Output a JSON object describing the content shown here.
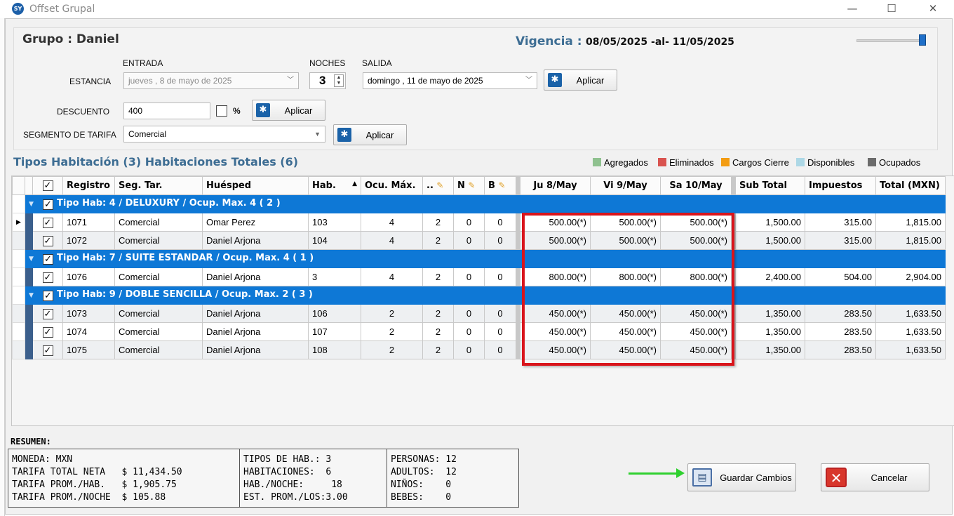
{
  "window": {
    "title": "Offset Grupal",
    "app_icon_text": "SY",
    "minimize": "—",
    "maximize": "☐",
    "close": "✕"
  },
  "header": {
    "grupo": "Grupo : Daniel",
    "vigencia_label": "Vigencia :",
    "vigencia_value": "08/05/2025 -al- 11/05/2025"
  },
  "stay": {
    "entrada_label": "ENTRADA",
    "noches_label": "NOCHES",
    "salida_label": "SALIDA",
    "estancia_label": "ESTANCIA",
    "entrada_value": "jueves  ,   8 de    mayo    de 2025",
    "noches_value": "3",
    "salida_value": "domingo , 11 de     mayo     de 2025",
    "apply_label": "Aplicar"
  },
  "discount": {
    "label": "DESCUENTO",
    "value": "400",
    "percent_label": "%",
    "apply_label": "Aplicar"
  },
  "segment": {
    "label": "SEGMENTO DE TARIFA",
    "value": "Comercial",
    "apply_label": "Aplicar"
  },
  "tipos_title": "Tipos Habitación (3) Habitaciones Totales (6)",
  "legend": [
    {
      "label": "Agregados",
      "color": "#8fc18f"
    },
    {
      "label": "Eliminados",
      "color": "#d9534f"
    },
    {
      "label": "Cargos Cierre",
      "color": "#f39c12"
    },
    {
      "label": "Disponibles",
      "color": "#add8e6"
    },
    {
      "label": "Ocupados",
      "color": "#6b6b6b"
    }
  ],
  "grid": {
    "columns": {
      "registro": "Registro",
      "seg": "Seg. Tar.",
      "huesped": "Huésped",
      "hab": "Hab.",
      "ocu": "Ocu. Máx.",
      "dots": "..",
      "n": "N",
      "b": "B",
      "d1": "Ju 8/May",
      "d2": "Vi 9/May",
      "d3": "Sa 10/May",
      "sub": "Sub Total",
      "imp": "Impuestos",
      "total": "Total (MXN)"
    },
    "groups": [
      {
        "label": "Tipo Hab: 4 / DELUXURY / Ocup. Max. 4 ( 2 )"
      },
      {
        "label": "Tipo Hab: 7 / SUITE ESTANDAR / Ocup. Max. 4 ( 1 )"
      },
      {
        "label": "Tipo Hab: 9 / DOBLE SENCILLA / Ocup. Max. 2 ( 3 )"
      }
    ],
    "rows": [
      {
        "registro": "1071",
        "seg": "Comercial",
        "huesped": "Omar Perez",
        "hab": "103",
        "ocu": "4",
        "dots": "2",
        "n": "0",
        "b": "0",
        "d1": "500.00(*)",
        "d2": "500.00(*)",
        "d3": "500.00(*)",
        "sub": "1,500.00",
        "imp": "315.00",
        "total": "1,815.00"
      },
      {
        "registro": "1072",
        "seg": "Comercial",
        "huesped": "Daniel Arjona",
        "hab": "104",
        "ocu": "4",
        "dots": "2",
        "n": "0",
        "b": "0",
        "d1": "500.00(*)",
        "d2": "500.00(*)",
        "d3": "500.00(*)",
        "sub": "1,500.00",
        "imp": "315.00",
        "total": "1,815.00"
      },
      {
        "registro": "1076",
        "seg": "Comercial",
        "huesped": "Daniel Arjona",
        "hab": "3",
        "ocu": "4",
        "dots": "2",
        "n": "0",
        "b": "0",
        "d1": "800.00(*)",
        "d2": "800.00(*)",
        "d3": "800.00(*)",
        "sub": "2,400.00",
        "imp": "504.00",
        "total": "2,904.00"
      },
      {
        "registro": "1073",
        "seg": "Comercial",
        "huesped": "Daniel Arjona",
        "hab": "106",
        "ocu": "2",
        "dots": "2",
        "n": "0",
        "b": "0",
        "d1": "450.00(*)",
        "d2": "450.00(*)",
        "d3": "450.00(*)",
        "sub": "1,350.00",
        "imp": "283.50",
        "total": "1,633.50"
      },
      {
        "registro": "1074",
        "seg": "Comercial",
        "huesped": "Daniel Arjona",
        "hab": "107",
        "ocu": "2",
        "dots": "2",
        "n": "0",
        "b": "0",
        "d1": "450.00(*)",
        "d2": "450.00(*)",
        "d3": "450.00(*)",
        "sub": "1,350.00",
        "imp": "283.50",
        "total": "1,633.50"
      },
      {
        "registro": "1075",
        "seg": "Comercial",
        "huesped": "Daniel Arjona",
        "hab": "108",
        "ocu": "2",
        "dots": "2",
        "n": "0",
        "b": "0",
        "d1": "450.00(*)",
        "d2": "450.00(*)",
        "d3": "450.00(*)",
        "sub": "1,350.00",
        "imp": "283.50",
        "total": "1,633.50"
      }
    ]
  },
  "resumen": {
    "label": "RESUMEN:",
    "col1": {
      "line1": "MONEDA: MXN",
      "line2": "TARIFA TOTAL NETA   $ 11,434.50",
      "line3": "TARIFA PROM./HAB.   $ 1,905.75",
      "line4": "TARIFA PROM./NOCHE  $ 105.88"
    },
    "col2": {
      "line1": "TIPOS DE HAB.: 3",
      "line2": "HABITACIONES:  6",
      "line3": "HAB./NOCHE:     18",
      "line4": "EST. PROM./LOS:3.00"
    },
    "col3": {
      "line1": "PERSONAS: 12",
      "line2": "ADULTOS:  12",
      "line3": "NIÑOS:    0",
      "line4": "BEBES:    0"
    }
  },
  "actions": {
    "save_label": "Guardar Cambios",
    "cancel_label": "Cancelar"
  }
}
